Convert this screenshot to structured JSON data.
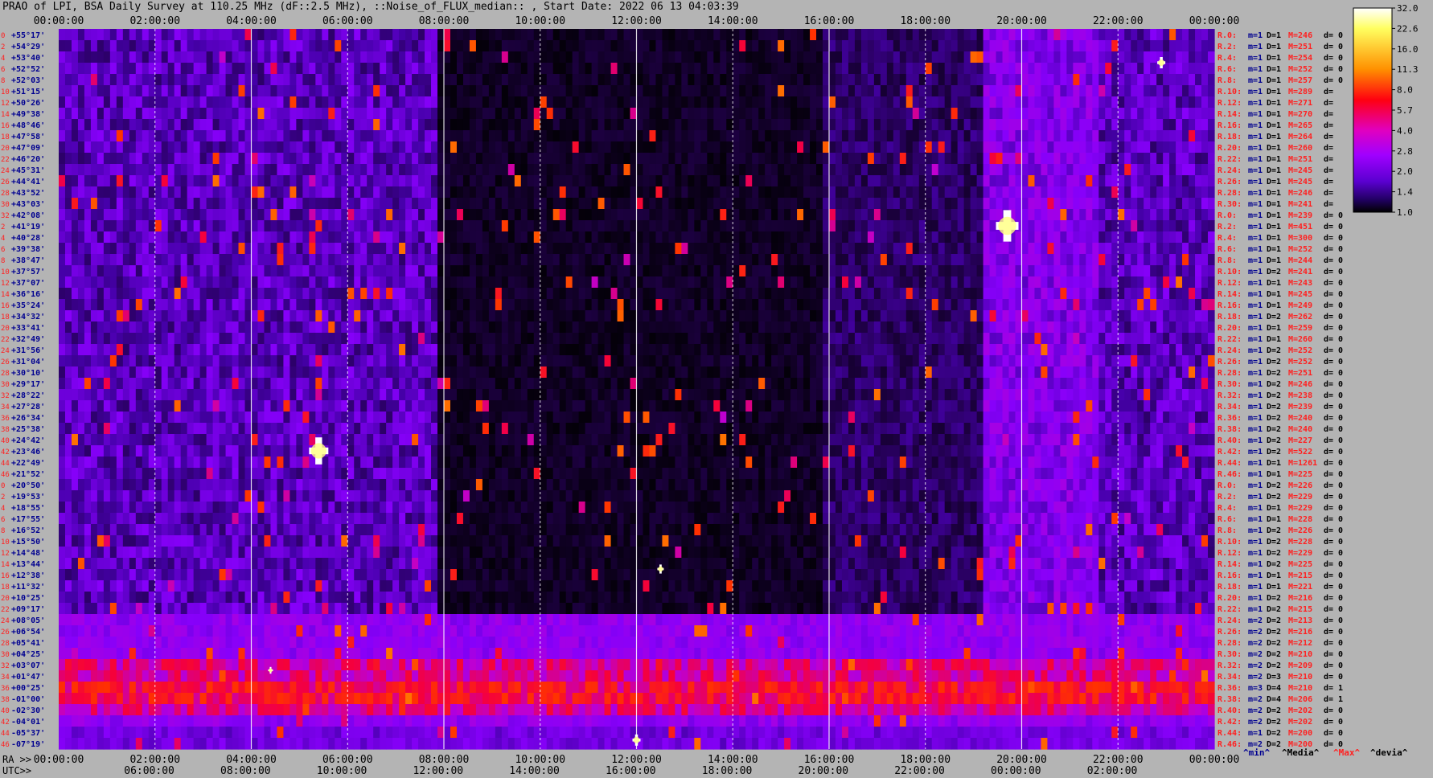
{
  "title": "PRAO of LPI, BSA Daily Survey at 110.25 MHz (dF::2.5 MHz), ::Noise_of_FLUX_median:: , Start Date: 2022 06 13 04:03:39",
  "chart_data": {
    "type": "heatmap",
    "top_axis_ticks": [
      "00:00:00",
      "02:00:00",
      "04:00:00",
      "06:00:00",
      "08:00:00",
      "10:00:00",
      "12:00:00",
      "14:00:00",
      "16:00:00",
      "18:00:00",
      "20:00:00",
      "22:00:00",
      "00:00:00"
    ],
    "bottom_axis_ra_label": "RA >>",
    "bottom_axis_ra_ticks": [
      "00:00:00",
      "02:00:00",
      "04:00:00",
      "06:00:00",
      "08:00:00",
      "10:00:00",
      "12:00:00",
      "14:00:00",
      "16:00:00",
      "18:00:00",
      "20:00:00",
      "22:00:00",
      "00:00:00"
    ],
    "bottom_axis_utc_label": "UTC>>",
    "bottom_axis_utc_ticks": [
      "06:00:00",
      "08:00:00",
      "10:00:00",
      "12:00:00",
      "14:00:00",
      "16:00:00",
      "18:00:00",
      "20:00:00",
      "22:00:00",
      "00:00:00",
      "02:00:00"
    ],
    "dec_labels": [
      "+55°17'",
      "+54°29'",
      "+53°40'",
      "+52°52'",
      "+52°03'",
      "+51°15'",
      "+50°26'",
      "+49°38'",
      "+48°46'",
      "+47°58'",
      "+47°09'",
      "+46°20'",
      "+45°31'",
      "+44°41'",
      "+43°52'",
      "+43°03'",
      "+42°08'",
      "+41°19'",
      "+40°28'",
      "+39°38'",
      "+38°47'",
      "+37°57'",
      "+37°07'",
      "+36°16'",
      "+35°24'",
      "+34°32'",
      "+33°41'",
      "+32°49'",
      "+31°56'",
      "+31°04'",
      "+30°10'",
      "+29°17'",
      "+28°22'",
      "+27°28'",
      "+26°34'",
      "+25°38'",
      "+24°42'",
      "+23°46'",
      "+22°49'",
      "+21°52'",
      "+20°50'",
      "+19°53'",
      "+18°55'",
      "+17°55'",
      "+16°52'",
      "+15°50'",
      "+14°48'",
      "+13°44'",
      "+12°38'",
      "+11°32'",
      "+10°25'",
      "+09°17'",
      "+08°05'",
      "+06°54'",
      "+05°41'",
      "+04°25'",
      "+03°07'",
      "+01°47'",
      "+00°25'",
      "-01°00'",
      "-02°30'",
      "-04°01'",
      "-05°37'",
      "-07°19'"
    ],
    "row_numbers": [
      "0",
      "2",
      "4",
      "6",
      "8",
      "10",
      "12",
      "14",
      "16",
      "18",
      "20",
      "22",
      "24",
      "26",
      "28",
      "30",
      "32",
      "2",
      "4",
      "6",
      "8",
      "10",
      "12",
      "14",
      "16",
      "18",
      "20",
      "22",
      "24",
      "26",
      "28",
      "30",
      "32",
      "34",
      "36",
      "38",
      "40",
      "42",
      "44",
      "46",
      "0",
      "2",
      "4",
      "6",
      "8",
      "10",
      "12",
      "14",
      "16",
      "18",
      "20",
      "22",
      "24",
      "26",
      "28",
      "30",
      "32",
      "34",
      "36",
      "38",
      "40",
      "42",
      "44",
      "46"
    ],
    "stats_rows": [
      {
        "r": "R.0:",
        "m": "m=1",
        "D": "D=1",
        "M": "M=246",
        "d": "d= 0"
      },
      {
        "r": "R.2:",
        "m": "m=1",
        "D": "D=1",
        "M": "M=251",
        "d": "d= 0"
      },
      {
        "r": "R.4:",
        "m": "m=1",
        "D": "D=1",
        "M": "M=254",
        "d": "d= 0"
      },
      {
        "r": "R.6:",
        "m": "m=1",
        "D": "D=1",
        "M": "M=252",
        "d": "d= 0"
      },
      {
        "r": "R.8:",
        "m": "m=1",
        "D": "D=1",
        "M": "M=257",
        "d": "d= 0"
      },
      {
        "r": "R.10:",
        "m": "m=1",
        "D": "D=1",
        "M": "M=289",
        "d": "d="
      },
      {
        "r": "R.12:",
        "m": "m=1",
        "D": "D=1",
        "M": "M=271",
        "d": "d="
      },
      {
        "r": "R.14:",
        "m": "m=1",
        "D": "D=1",
        "M": "M=270",
        "d": "d="
      },
      {
        "r": "R.16:",
        "m": "m=1",
        "D": "D=1",
        "M": "M=265",
        "d": "d="
      },
      {
        "r": "R.18:",
        "m": "m=1",
        "D": "D=1",
        "M": "M=264",
        "d": "d="
      },
      {
        "r": "R.20:",
        "m": "m=1",
        "D": "D=1",
        "M": "M=260",
        "d": "d="
      },
      {
        "r": "R.22:",
        "m": "m=1",
        "D": "D=1",
        "M": "M=251",
        "d": "d="
      },
      {
        "r": "R.24:",
        "m": "m=1",
        "D": "D=1",
        "M": "M=245",
        "d": "d="
      },
      {
        "r": "R.26:",
        "m": "m=1",
        "D": "D=1",
        "M": "M=245",
        "d": "d="
      },
      {
        "r": "R.28:",
        "m": "m=1",
        "D": "D=1",
        "M": "M=246",
        "d": "d="
      },
      {
        "r": "R.30:",
        "m": "m=1",
        "D": "D=1",
        "M": "M=241",
        "d": "d="
      },
      {
        "r": "R.0:",
        "m": "m=1",
        "D": "D=1",
        "M": "M=239",
        "d": "d= 0"
      },
      {
        "r": "R.2:",
        "m": "m=1",
        "D": "D=1",
        "M": "M=451",
        "d": "d= 0"
      },
      {
        "r": "R.4:",
        "m": "m=1",
        "D": "D=1",
        "M": "M=300",
        "d": "d= 0"
      },
      {
        "r": "R.6:",
        "m": "m=1",
        "D": "D=1",
        "M": "M=252",
        "d": "d= 0"
      },
      {
        "r": "R.8:",
        "m": "m=1",
        "D": "D=1",
        "M": "M=244",
        "d": "d= 0"
      },
      {
        "r": "R.10:",
        "m": "m=1",
        "D": "D=2",
        "M": "M=241",
        "d": "d= 0"
      },
      {
        "r": "R.12:",
        "m": "m=1",
        "D": "D=1",
        "M": "M=243",
        "d": "d= 0"
      },
      {
        "r": "R.14:",
        "m": "m=1",
        "D": "D=1",
        "M": "M=245",
        "d": "d= 0"
      },
      {
        "r": "R.16:",
        "m": "m=1",
        "D": "D=1",
        "M": "M=249",
        "d": "d= 0"
      },
      {
        "r": "R.18:",
        "m": "m=1",
        "D": "D=2",
        "M": "M=262",
        "d": "d= 0"
      },
      {
        "r": "R.20:",
        "m": "m=1",
        "D": "D=1",
        "M": "M=259",
        "d": "d= 0"
      },
      {
        "r": "R.22:",
        "m": "m=1",
        "D": "D=1",
        "M": "M=260",
        "d": "d= 0"
      },
      {
        "r": "R.24:",
        "m": "m=1",
        "D": "D=2",
        "M": "M=252",
        "d": "d= 0"
      },
      {
        "r": "R.26:",
        "m": "m=1",
        "D": "D=2",
        "M": "M=252",
        "d": "d= 0"
      },
      {
        "r": "R.28:",
        "m": "m=1",
        "D": "D=2",
        "M": "M=251",
        "d": "d= 0"
      },
      {
        "r": "R.30:",
        "m": "m=1",
        "D": "D=2",
        "M": "M=246",
        "d": "d= 0"
      },
      {
        "r": "R.32:",
        "m": "m=1",
        "D": "D=2",
        "M": "M=238",
        "d": "d= 0"
      },
      {
        "r": "R.34:",
        "m": "m=1",
        "D": "D=2",
        "M": "M=239",
        "d": "d= 0"
      },
      {
        "r": "R.36:",
        "m": "m=1",
        "D": "D=2",
        "M": "M=240",
        "d": "d= 0"
      },
      {
        "r": "R.38:",
        "m": "m=1",
        "D": "D=2",
        "M": "M=240",
        "d": "d= 0"
      },
      {
        "r": "R.40:",
        "m": "m=1",
        "D": "D=2",
        "M": "M=227",
        "d": "d= 0"
      },
      {
        "r": "R.42:",
        "m": "m=1",
        "D": "D=2",
        "M": "M=522",
        "d": "d= 0"
      },
      {
        "r": "R.44:",
        "m": "m=1",
        "D": "D=1",
        "M": "M=1261",
        "d": "d= 0"
      },
      {
        "r": "R.46:",
        "m": "m=1",
        "D": "D=1",
        "M": "M=225",
        "d": "d= 0"
      },
      {
        "r": "R.0:",
        "m": "m=1",
        "D": "D=2",
        "M": "M=226",
        "d": "d= 0"
      },
      {
        "r": "R.2:",
        "m": "m=1",
        "D": "D=2",
        "M": "M=229",
        "d": "d= 0"
      },
      {
        "r": "R.4:",
        "m": "m=1",
        "D": "D=1",
        "M": "M=229",
        "d": "d= 0"
      },
      {
        "r": "R.6:",
        "m": "m=1",
        "D": "D=1",
        "M": "M=228",
        "d": "d= 0"
      },
      {
        "r": "R.8:",
        "m": "m=1",
        "D": "D=2",
        "M": "M=226",
        "d": "d= 0"
      },
      {
        "r": "R.10:",
        "m": "m=1",
        "D": "D=2",
        "M": "M=228",
        "d": "d= 0"
      },
      {
        "r": "R.12:",
        "m": "m=1",
        "D": "D=2",
        "M": "M=229",
        "d": "d= 0"
      },
      {
        "r": "R.14:",
        "m": "m=1",
        "D": "D=2",
        "M": "M=225",
        "d": "d= 0"
      },
      {
        "r": "R.16:",
        "m": "m=1",
        "D": "D=1",
        "M": "M=215",
        "d": "d= 0"
      },
      {
        "r": "R.18:",
        "m": "m=1",
        "D": "D=1",
        "M": "M=221",
        "d": "d= 0"
      },
      {
        "r": "R.20:",
        "m": "m=1",
        "D": "D=2",
        "M": "M=216",
        "d": "d= 0"
      },
      {
        "r": "R.22:",
        "m": "m=1",
        "D": "D=2",
        "M": "M=215",
        "d": "d= 0"
      },
      {
        "r": "R.24:",
        "m": "m=2",
        "D": "D=2",
        "M": "M=213",
        "d": "d= 0"
      },
      {
        "r": "R.26:",
        "m": "m=2",
        "D": "D=2",
        "M": "M=216",
        "d": "d= 0"
      },
      {
        "r": "R.28:",
        "m": "m=2",
        "D": "D=2",
        "M": "M=212",
        "d": "d= 0"
      },
      {
        "r": "R.30:",
        "m": "m=2",
        "D": "D=2",
        "M": "M=210",
        "d": "d= 0"
      },
      {
        "r": "R.32:",
        "m": "m=2",
        "D": "D=2",
        "M": "M=209",
        "d": "d= 0"
      },
      {
        "r": "R.34:",
        "m": "m=2",
        "D": "D=3",
        "M": "M=210",
        "d": "d= 0"
      },
      {
        "r": "R.36:",
        "m": "m=3",
        "D": "D=4",
        "M": "M=210",
        "d": "d= 1"
      },
      {
        "r": "R.38:",
        "m": "m=2",
        "D": "D=4",
        "M": "M=206",
        "d": "d= 1"
      },
      {
        "r": "R.40:",
        "m": "m=2",
        "D": "D=2",
        "M": "M=202",
        "d": "d= 0"
      },
      {
        "r": "R.42:",
        "m": "m=2",
        "D": "D=2",
        "M": "M=202",
        "d": "d= 0"
      },
      {
        "r": "R.44:",
        "m": "m=1",
        "D": "D=2",
        "M": "M=200",
        "d": "d= 0"
      },
      {
        "r": "R.46:",
        "m": "m=2",
        "D": "D=2",
        "M": "M=200",
        "d": "d= 0"
      }
    ],
    "stats_footer": [
      "^min^",
      "^Media^",
      "^Max^",
      "^devia^"
    ],
    "colorbar_ticks": [
      "32.0",
      "22.6",
      "16.0",
      "11.3",
      "8.0",
      "5.7",
      "4.0",
      "2.8",
      "2.0",
      "1.4",
      "1.0"
    ],
    "colors": {
      "page": "#b4b4b4",
      "stat_red": "#ff2020",
      "stat_blue": "#000090"
    }
  }
}
